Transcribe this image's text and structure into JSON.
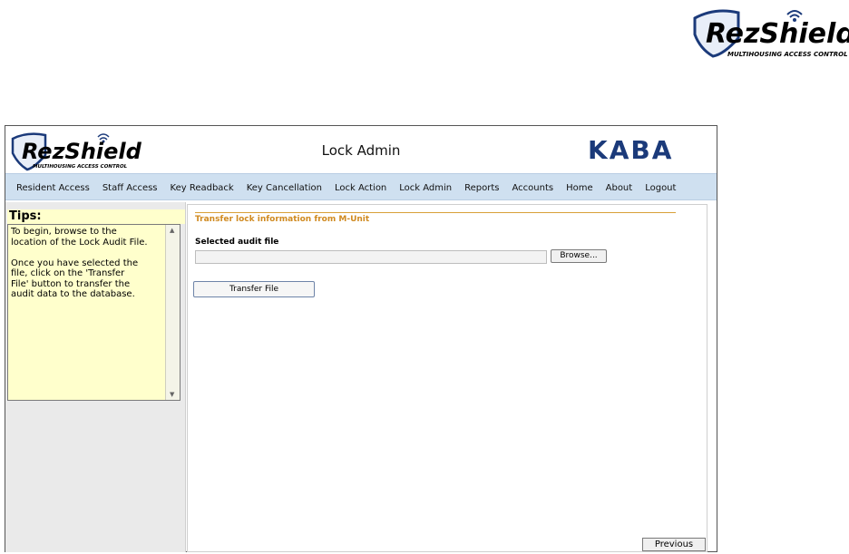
{
  "branding": {
    "logo_text": "RezShield",
    "logo_tagline": "MULTIHOUSING ACCESS CONTROL",
    "partner_logo_text": "KABA"
  },
  "header": {
    "title": "Lock Admin"
  },
  "nav": {
    "items": [
      "Resident Access",
      "Staff Access",
      "Key Readback",
      "Key Cancellation",
      "Lock Action",
      "Lock Admin",
      "Reports",
      "Accounts",
      "Home",
      "About",
      "Logout"
    ]
  },
  "sidebar": {
    "tips_title": "Tips:",
    "tips_text": "To begin, browse to the\nlocation of the Lock Audit File.\n\nOnce you have selected the\nfile, click on the 'Transfer\nFile' button to transfer the\naudit data to the database."
  },
  "main": {
    "section_title": "Transfer lock information from M-Unit",
    "field_label": "Selected audit file",
    "file_value": "",
    "browse_label": "Browse...",
    "transfer_label": "Transfer File"
  },
  "footer": {
    "previous_label": "Previous"
  },
  "colors": {
    "brand_blue": "#1b3a7a",
    "nav_background": "#cfe0f0",
    "tips_background": "#ffffcc",
    "section_accent": "#d08a20"
  }
}
